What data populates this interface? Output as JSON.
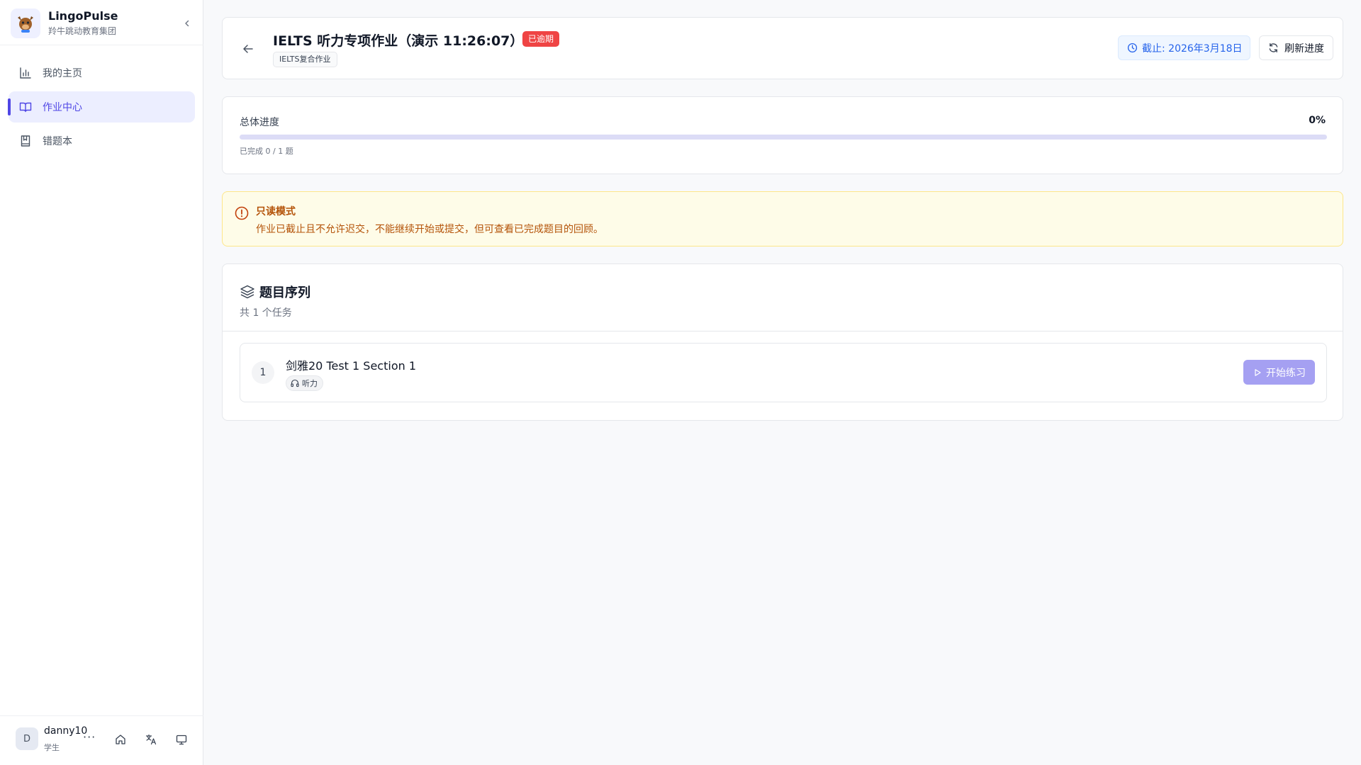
{
  "app": {
    "name": "LingoPulse",
    "org": "羚牛跳动教育集团"
  },
  "sidebar": {
    "items": [
      {
        "label": "我的主页",
        "icon": "bar-chart-icon",
        "active": false
      },
      {
        "label": "作业中心",
        "icon": "book-open-icon",
        "active": true
      },
      {
        "label": "错题本",
        "icon": "bookmark-book-icon",
        "active": false
      }
    ]
  },
  "user": {
    "initial": "D",
    "name": "danny10",
    "role": "学生",
    "more": "···"
  },
  "assignment": {
    "title": "IELTS 听力专项作业（演示 11:26:07）",
    "status_badge": "已逾期",
    "type_tag": "IELTS复合作业",
    "deadline": "截止: 2026年3月18日",
    "refresh_label": "刷新进度"
  },
  "progress": {
    "label": "总体进度",
    "percent_text": "0%",
    "percent": 0,
    "count_text": "已完成 0 / 1 题"
  },
  "warning": {
    "title": "只读模式",
    "message": "作业已截止且不允许迟交，不能继续开始或提交，但可查看已完成题目的回顾。"
  },
  "tasks": {
    "title": "题目序列",
    "subtitle": "共 1 个任务",
    "items": [
      {
        "index": "1",
        "title": "剑雅20 Test 1 Section 1",
        "skill": "听力",
        "action": "开始练习"
      }
    ]
  },
  "colors": {
    "accent": "#4f46e5",
    "danger": "#ef4444",
    "warning_text": "#b45309",
    "deadline_blue": "#2563eb"
  }
}
